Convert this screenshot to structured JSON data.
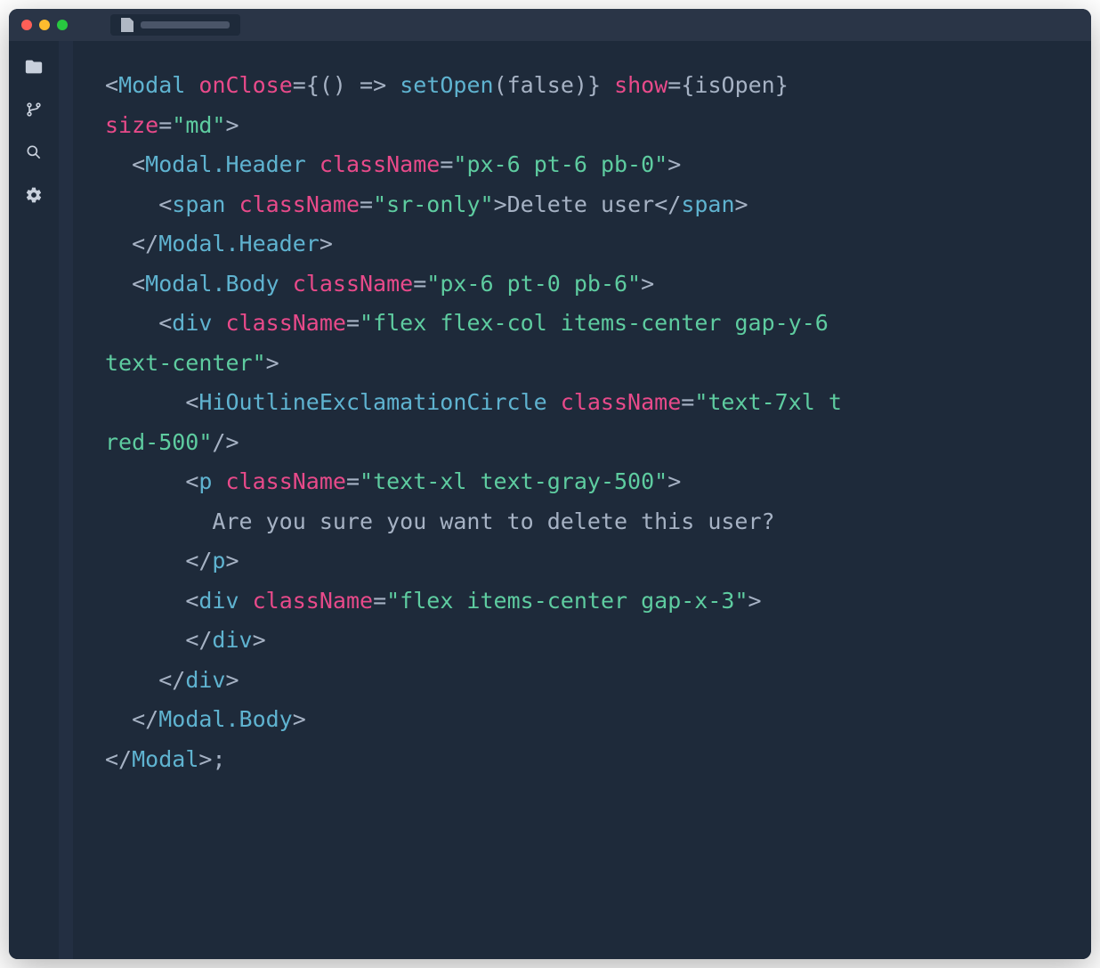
{
  "titlebar": {
    "traffic_lights": [
      "red",
      "yellow",
      "green"
    ],
    "tab_placeholder": ""
  },
  "sidebar": {
    "items": [
      {
        "name": "folder-icon"
      },
      {
        "name": "git-branch-icon"
      },
      {
        "name": "search-icon"
      },
      {
        "name": "gear-icon"
      }
    ]
  },
  "code": {
    "lines": [
      {
        "parts": [
          {
            "c": "punct",
            "t": "<"
          },
          {
            "c": "tag",
            "t": "Modal"
          },
          {
            "c": "text",
            "t": " "
          },
          {
            "c": "attr",
            "t": "onClose"
          },
          {
            "c": "punct",
            "t": "="
          },
          {
            "c": "bracket",
            "t": "{"
          },
          {
            "c": "paren",
            "t": "() "
          },
          {
            "c": "punct",
            "t": "=>"
          },
          {
            "c": "text",
            "t": " "
          },
          {
            "c": "fn",
            "t": "setOpen"
          },
          {
            "c": "paren",
            "t": "("
          },
          {
            "c": "text",
            "t": "false"
          },
          {
            "c": "paren",
            "t": ")"
          },
          {
            "c": "bracket",
            "t": "}"
          },
          {
            "c": "text",
            "t": " "
          },
          {
            "c": "attr",
            "t": "show"
          },
          {
            "c": "punct",
            "t": "="
          },
          {
            "c": "bracket",
            "t": "{"
          },
          {
            "c": "text",
            "t": "isOpen"
          },
          {
            "c": "bracket",
            "t": "}"
          }
        ]
      },
      {
        "parts": [
          {
            "c": "attr",
            "t": "size"
          },
          {
            "c": "punct",
            "t": "="
          },
          {
            "c": "str",
            "t": "\"md\""
          },
          {
            "c": "punct",
            "t": ">"
          }
        ]
      },
      {
        "indent": 1,
        "parts": [
          {
            "c": "punct",
            "t": "<"
          },
          {
            "c": "tag",
            "t": "Modal.Header"
          },
          {
            "c": "text",
            "t": " "
          },
          {
            "c": "attr",
            "t": "className"
          },
          {
            "c": "punct",
            "t": "="
          },
          {
            "c": "str",
            "t": "\"px-6 pt-6 pb-0\""
          },
          {
            "c": "punct",
            "t": ">"
          }
        ]
      },
      {
        "indent": 2,
        "parts": [
          {
            "c": "punct",
            "t": "<"
          },
          {
            "c": "tag",
            "t": "span"
          },
          {
            "c": "text",
            "t": " "
          },
          {
            "c": "attr",
            "t": "className"
          },
          {
            "c": "punct",
            "t": "="
          },
          {
            "c": "str",
            "t": "\"sr-only\""
          },
          {
            "c": "punct",
            "t": ">"
          },
          {
            "c": "text",
            "t": "Delete user"
          },
          {
            "c": "punct",
            "t": "</"
          },
          {
            "c": "tag",
            "t": "span"
          },
          {
            "c": "punct",
            "t": ">"
          }
        ]
      },
      {
        "indent": 1,
        "parts": [
          {
            "c": "punct",
            "t": "</"
          },
          {
            "c": "tag",
            "t": "Modal.Header"
          },
          {
            "c": "punct",
            "t": ">"
          }
        ]
      },
      {
        "indent": 1,
        "parts": [
          {
            "c": "punct",
            "t": "<"
          },
          {
            "c": "tag",
            "t": "Modal.Body"
          },
          {
            "c": "text",
            "t": " "
          },
          {
            "c": "attr",
            "t": "className"
          },
          {
            "c": "punct",
            "t": "="
          },
          {
            "c": "str",
            "t": "\"px-6 pt-0 pb-6\""
          },
          {
            "c": "punct",
            "t": ">"
          }
        ]
      },
      {
        "indent": 2,
        "parts": [
          {
            "c": "punct",
            "t": "<"
          },
          {
            "c": "tag",
            "t": "div"
          },
          {
            "c": "text",
            "t": " "
          },
          {
            "c": "attr",
            "t": "className"
          },
          {
            "c": "punct",
            "t": "="
          },
          {
            "c": "str",
            "t": "\"flex flex-col items-center gap-y-6 "
          }
        ]
      },
      {
        "parts": [
          {
            "c": "str",
            "t": "text-center\""
          },
          {
            "c": "punct",
            "t": ">"
          }
        ]
      },
      {
        "indent": 3,
        "parts": [
          {
            "c": "punct",
            "t": "<"
          },
          {
            "c": "tag",
            "t": "HiOutlineExclamationCircle"
          },
          {
            "c": "text",
            "t": " "
          },
          {
            "c": "attr",
            "t": "className"
          },
          {
            "c": "punct",
            "t": "="
          },
          {
            "c": "str",
            "t": "\"text-7xl t"
          }
        ]
      },
      {
        "parts": [
          {
            "c": "str",
            "t": "red-500\""
          },
          {
            "c": "punct",
            "t": "/>"
          }
        ]
      },
      {
        "indent": 3,
        "parts": [
          {
            "c": "punct",
            "t": "<"
          },
          {
            "c": "tag",
            "t": "p"
          },
          {
            "c": "text",
            "t": " "
          },
          {
            "c": "attr",
            "t": "className"
          },
          {
            "c": "punct",
            "t": "="
          },
          {
            "c": "str",
            "t": "\"text-xl text-gray-500\""
          },
          {
            "c": "punct",
            "t": ">"
          }
        ]
      },
      {
        "indent": 4,
        "parts": [
          {
            "c": "text",
            "t": "Are you sure you want to delete this user?"
          }
        ]
      },
      {
        "indent": 3,
        "parts": [
          {
            "c": "punct",
            "t": "</"
          },
          {
            "c": "tag",
            "t": "p"
          },
          {
            "c": "punct",
            "t": ">"
          }
        ]
      },
      {
        "indent": 3,
        "parts": [
          {
            "c": "punct",
            "t": "<"
          },
          {
            "c": "tag",
            "t": "div"
          },
          {
            "c": "text",
            "t": " "
          },
          {
            "c": "attr",
            "t": "className"
          },
          {
            "c": "punct",
            "t": "="
          },
          {
            "c": "str",
            "t": "\"flex items-center gap-x-3\""
          },
          {
            "c": "punct",
            "t": ">"
          }
        ]
      },
      {
        "indent": 3,
        "parts": [
          {
            "c": "punct",
            "t": "</"
          },
          {
            "c": "tag",
            "t": "div"
          },
          {
            "c": "punct",
            "t": ">"
          }
        ]
      },
      {
        "indent": 2,
        "parts": [
          {
            "c": "punct",
            "t": "</"
          },
          {
            "c": "tag",
            "t": "div"
          },
          {
            "c": "punct",
            "t": ">"
          }
        ]
      },
      {
        "indent": 1,
        "parts": [
          {
            "c": "punct",
            "t": "</"
          },
          {
            "c": "tag",
            "t": "Modal.Body"
          },
          {
            "c": "punct",
            "t": ">"
          }
        ]
      },
      {
        "parts": [
          {
            "c": "punct",
            "t": "</"
          },
          {
            "c": "tag",
            "t": "Modal"
          },
          {
            "c": "punct",
            "t": ">"
          },
          {
            "c": "text",
            "t": ";"
          }
        ]
      }
    ]
  }
}
